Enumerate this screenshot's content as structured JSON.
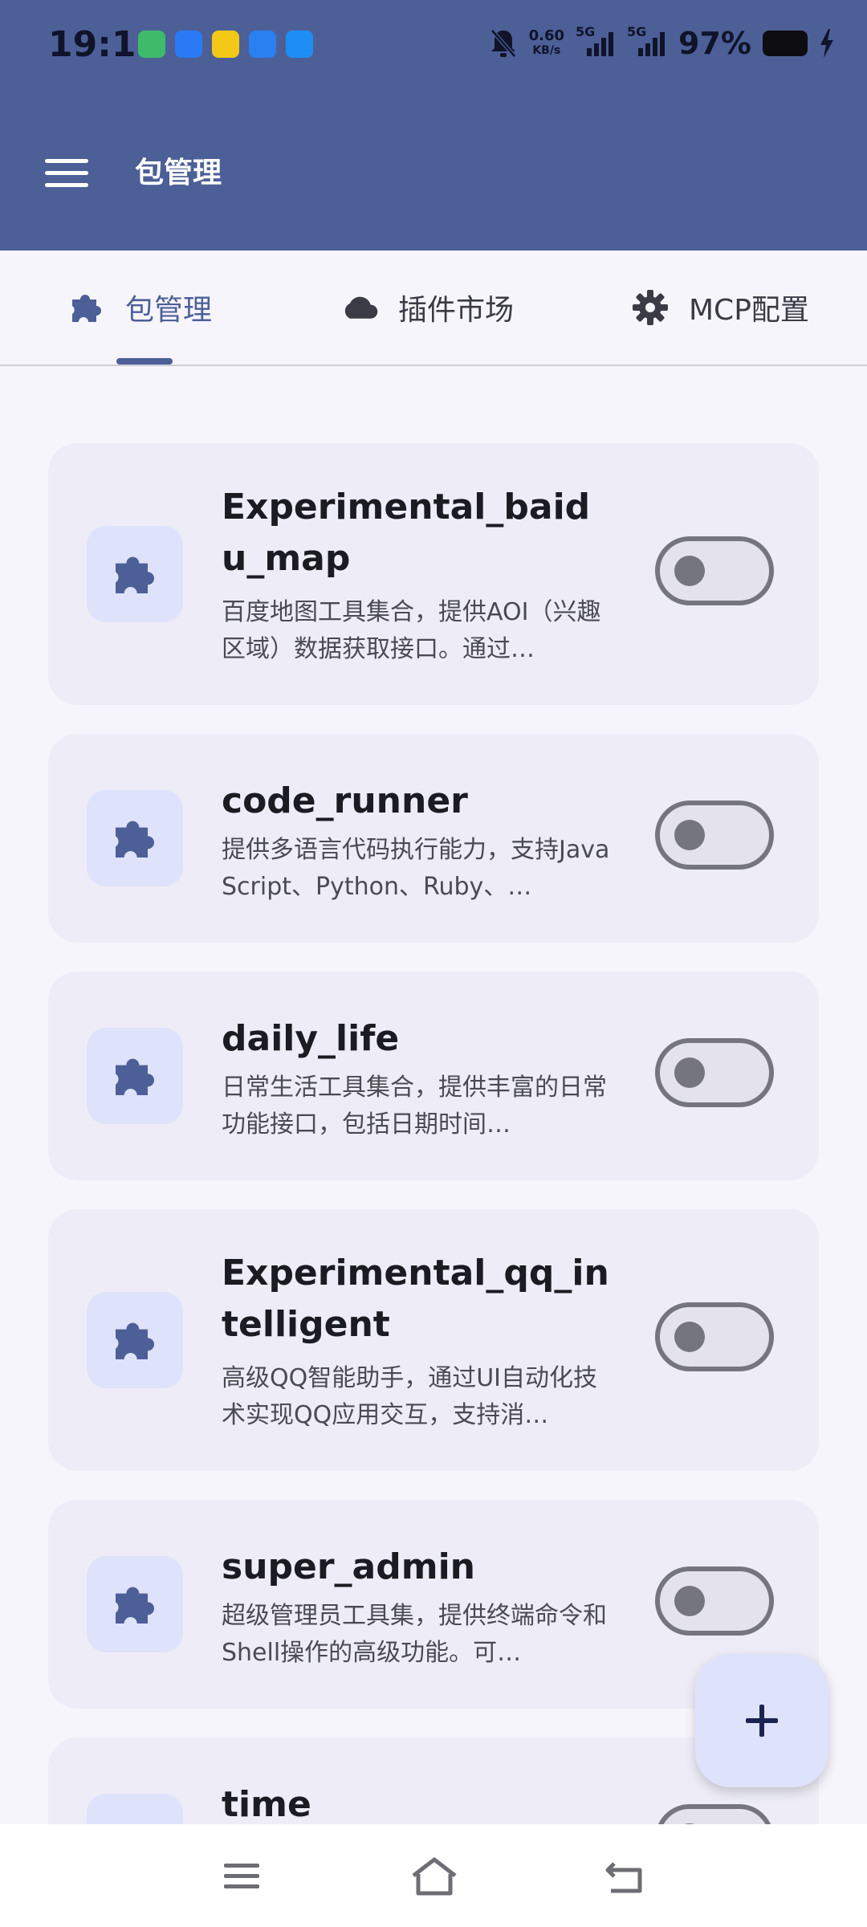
{
  "status_bar": {
    "time": "19:11",
    "net_speed_value": "0.60",
    "net_speed_unit": "KB/s",
    "signal_1": "5G",
    "signal_2": "5G",
    "battery": "97%"
  },
  "app_bar": {
    "title": "包管理"
  },
  "tabs": [
    {
      "label": "包管理",
      "icon": "puzzle-icon",
      "active": true
    },
    {
      "label": "插件市场",
      "icon": "cloud-icon",
      "active": false
    },
    {
      "label": "MCP配置",
      "icon": "gear-icon",
      "active": false
    }
  ],
  "packages": [
    {
      "name": "Experimental_baidu_map",
      "description": "百度地图工具集合，提供AOI（兴趣区域）数据获取接口。通过…",
      "enabled": false
    },
    {
      "name": "code_runner",
      "description": "提供多语言代码执行能力，支持JavaScript、Python、Ruby、…",
      "enabled": false
    },
    {
      "name": "daily_life",
      "description": "日常生活工具集合，提供丰富的日常功能接口，包括日期时间…",
      "enabled": false
    },
    {
      "name": "Experimental_qq_intelligent",
      "description": "高级QQ智能助手，通过UI自动化技术实现QQ应用交互，支持消…",
      "enabled": false
    },
    {
      "name": "super_admin",
      "description": "超级管理员工具集，提供终端命令和Shell操作的高级功能。可…",
      "enabled": false
    },
    {
      "name": "time",
      "description": "",
      "enabled": false
    }
  ],
  "fab": {
    "icon": "plus-icon"
  },
  "nav_bar": {
    "icons": [
      "menu-icon",
      "home-icon",
      "back-icon"
    ]
  },
  "colors": {
    "primary": "#4d5f97",
    "card": "#eeedf7",
    "icon_bg": "#dfe2fb"
  }
}
